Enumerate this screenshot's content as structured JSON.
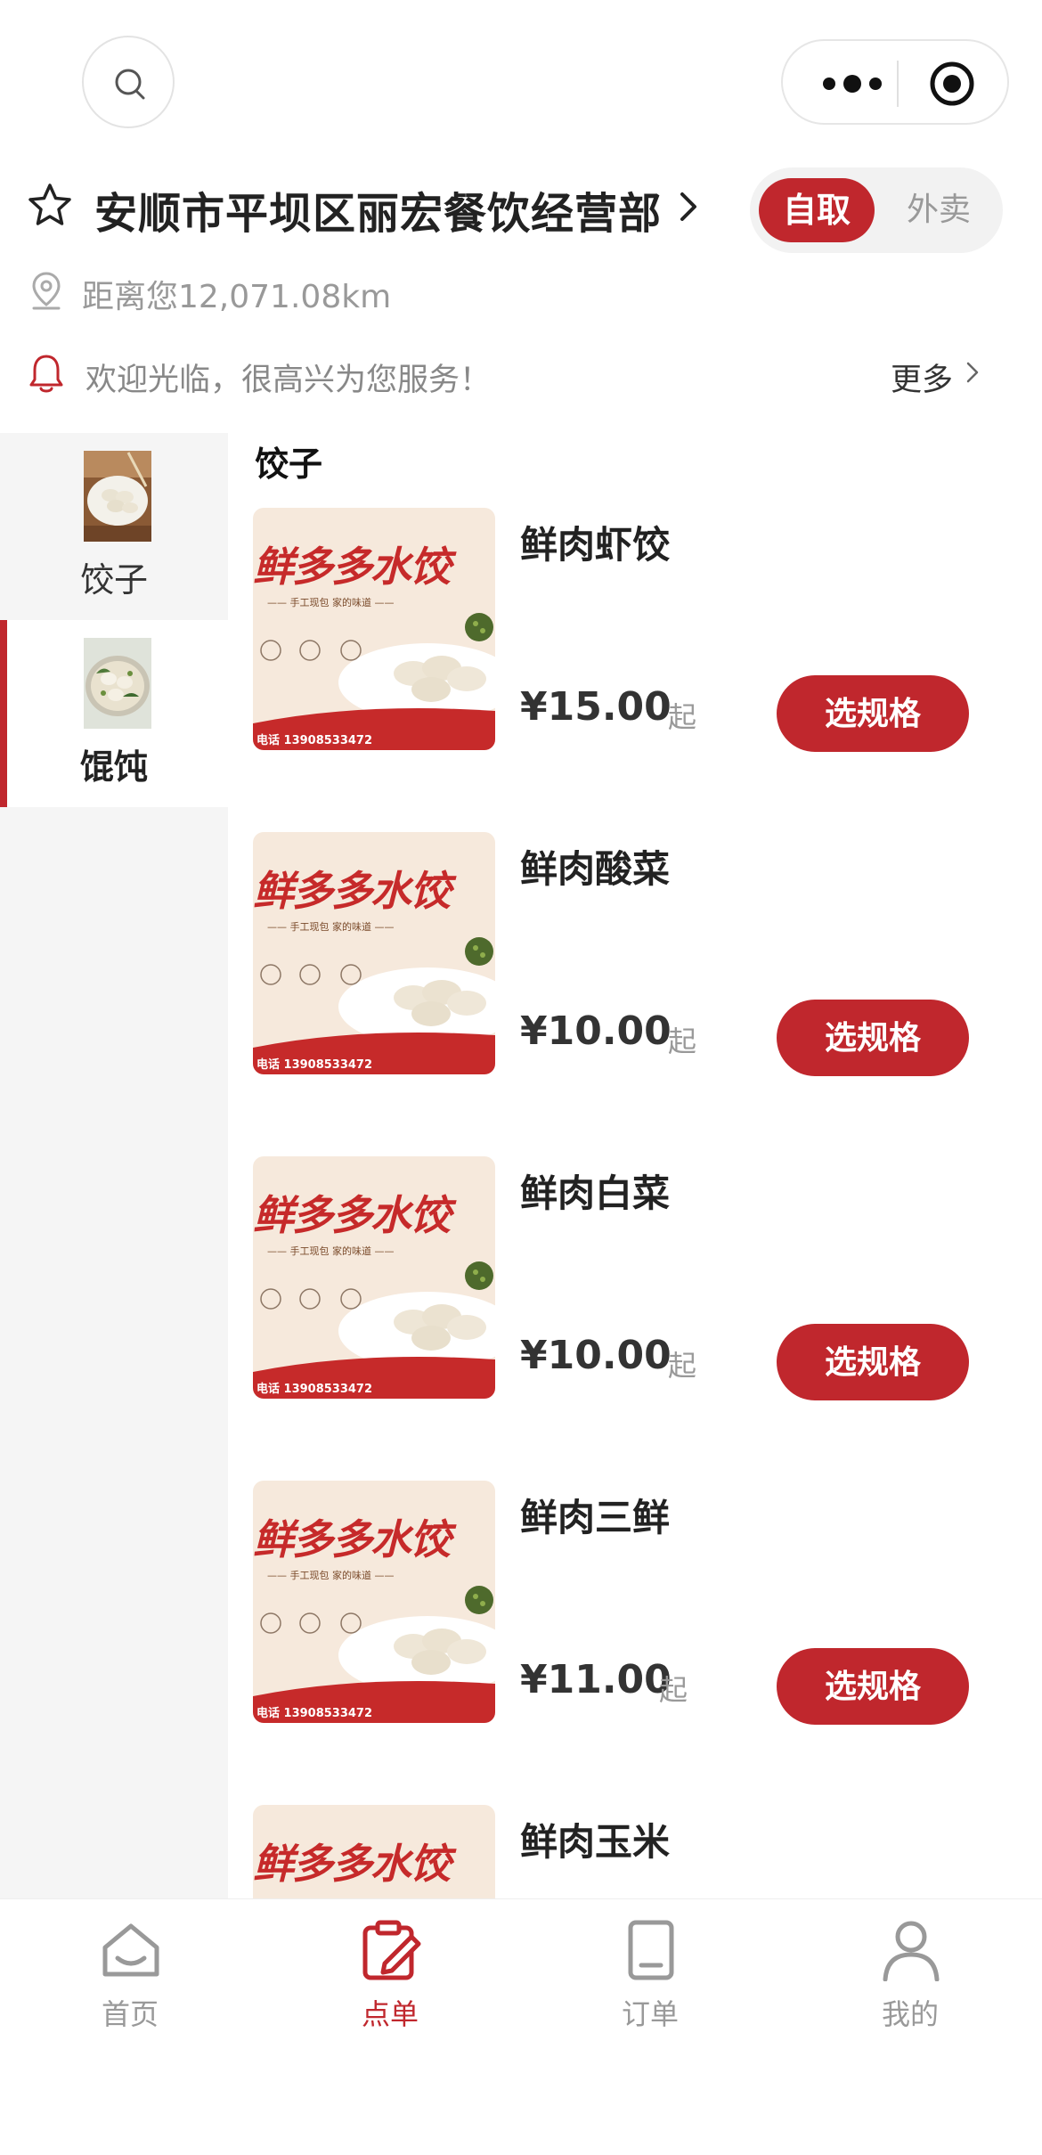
{
  "store": {
    "name": "安顺市平坝区丽宏餐饮经营部",
    "distance": "距离您12,071.08km",
    "notice": "欢迎光临，很高兴为您服务！",
    "more_label": "更多",
    "modes": {
      "active": "自取",
      "inactive": "外卖"
    }
  },
  "categories": [
    {
      "label": "饺子",
      "active": false
    },
    {
      "label": "馄饨",
      "active": true
    }
  ],
  "section_title": "饺子",
  "banner": {
    "title": "鲜多多水饺",
    "subtitle": "—— 手工现包  家的味道 ——",
    "phone": "电话 13908533472"
  },
  "products": [
    {
      "name": "鲜肉虾饺",
      "price": "¥15.00",
      "suffix": "起",
      "button": "选规格"
    },
    {
      "name": "鲜肉酸菜",
      "price": "¥10.00",
      "suffix": "起",
      "button": "选规格"
    },
    {
      "name": "鲜肉白菜",
      "price": "¥10.00",
      "suffix": "起",
      "button": "选规格"
    },
    {
      "name": "鲜肉三鲜",
      "price": "¥11.00",
      "suffix": "起",
      "button": "选规格"
    },
    {
      "name": "鲜肉玉米",
      "price": "",
      "suffix": "",
      "button": ""
    }
  ],
  "tabs": [
    {
      "label": "首页",
      "icon": "home-icon",
      "active": false
    },
    {
      "label": "点单",
      "icon": "order-edit-icon",
      "active": true
    },
    {
      "label": "订单",
      "icon": "receipt-icon",
      "active": false
    },
    {
      "label": "我的",
      "icon": "user-icon",
      "active": false
    }
  ],
  "colors": {
    "accent": "#c0272d",
    "muted": "#999999"
  }
}
